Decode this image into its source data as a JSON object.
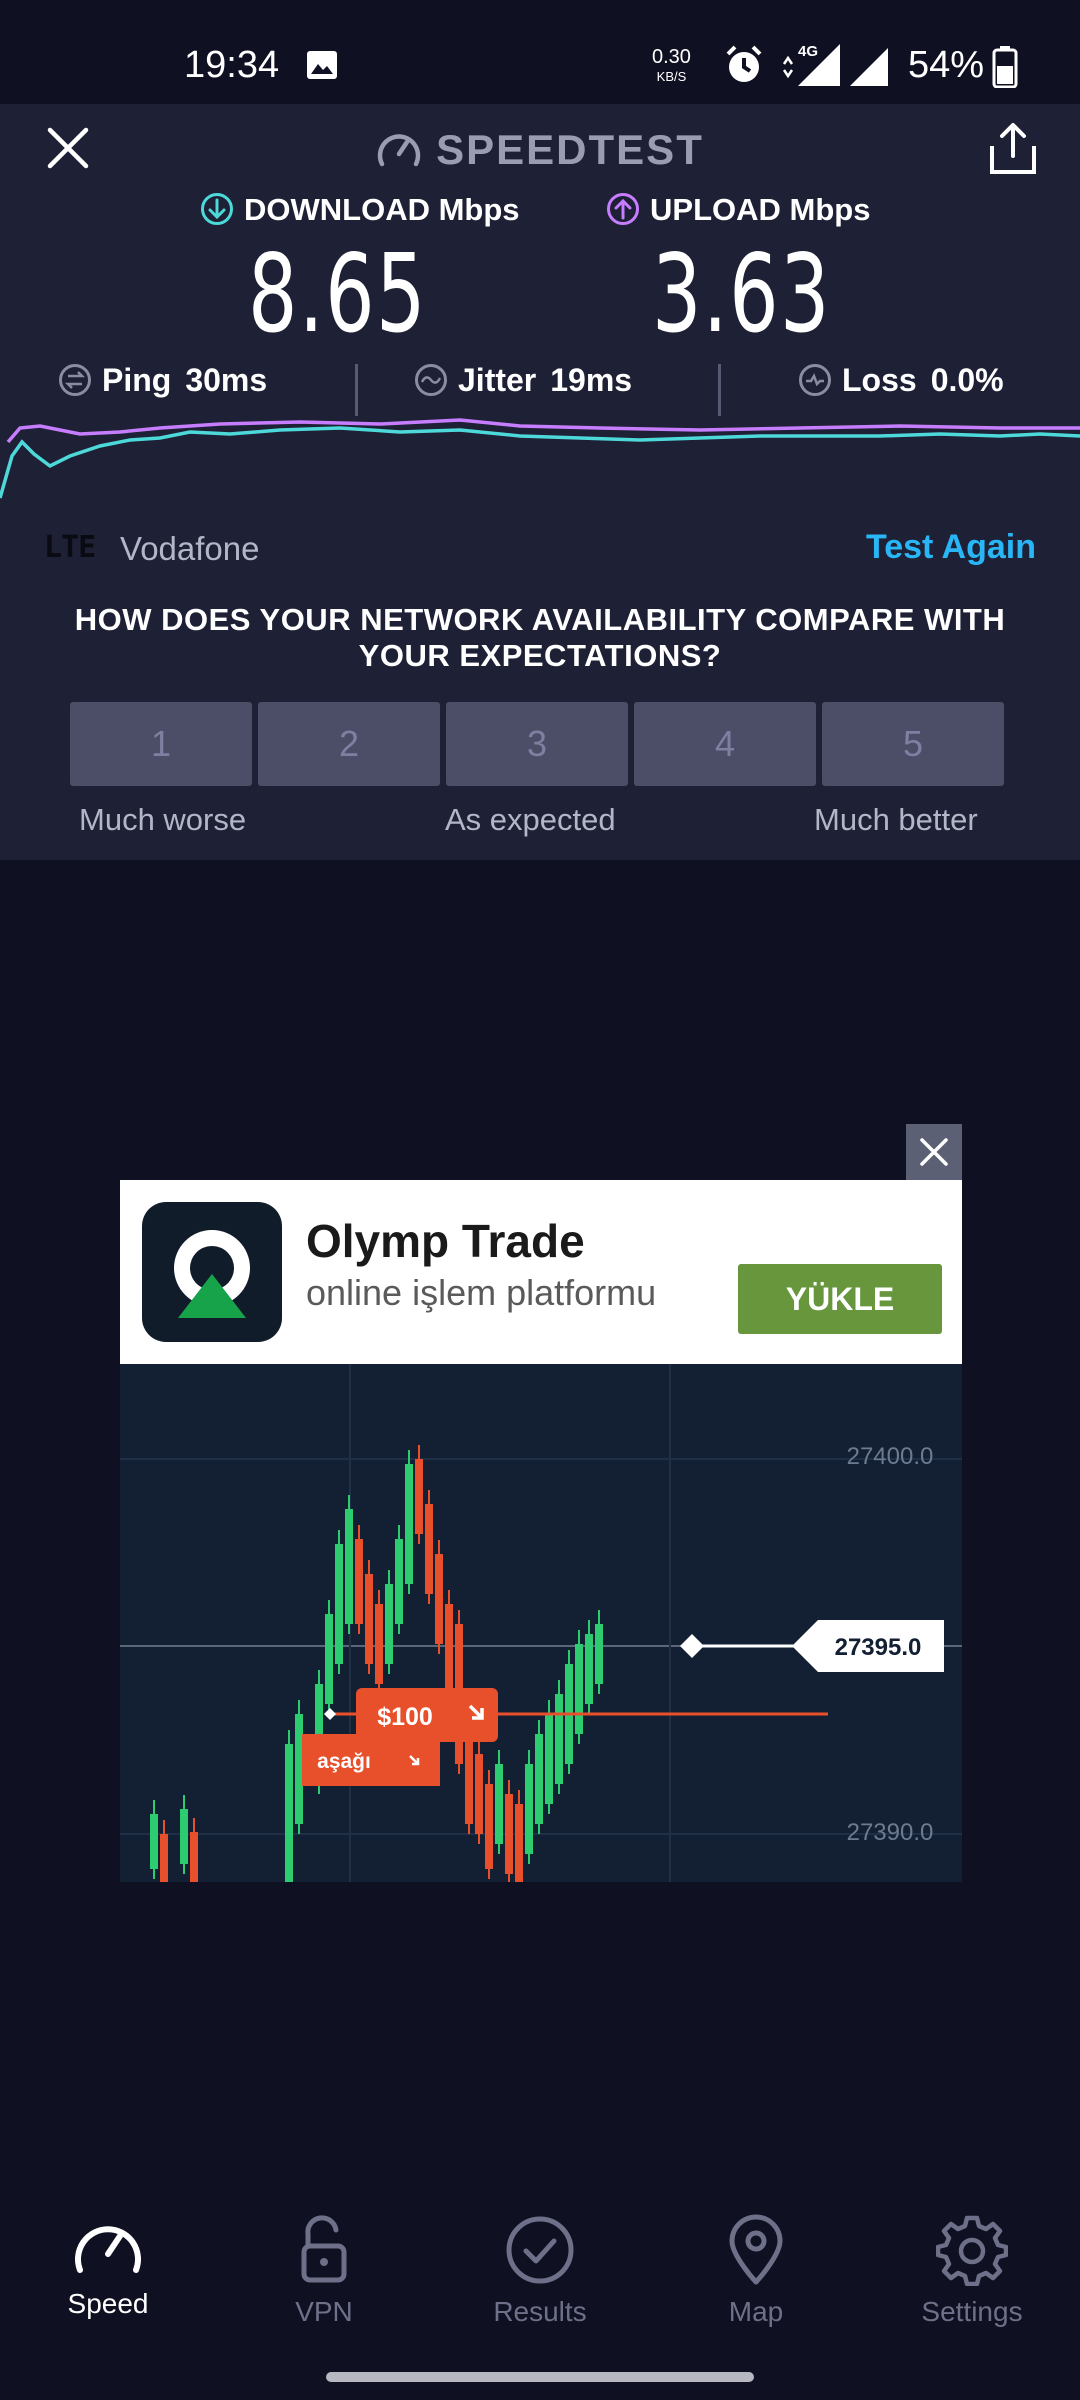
{
  "status_bar": {
    "time": "19:34",
    "net_speed_value": "0.30",
    "net_speed_unit": "KB/S",
    "network_type": "4G",
    "battery": "54%"
  },
  "header": {
    "title": "SPEEDTEST"
  },
  "results": {
    "download_label": "DOWNLOAD Mbps",
    "download_value": "8.65",
    "upload_label": "UPLOAD Mbps",
    "upload_value": "3.63",
    "ping_label": "Ping",
    "ping_value": "30ms",
    "jitter_label": "Jitter",
    "jitter_value": "19ms",
    "loss_label": "Loss",
    "loss_value": "0.0%"
  },
  "connection": {
    "type": "LTE",
    "carrier": "Vodafone",
    "test_again": "Test Again"
  },
  "survey": {
    "question": "HOW DOES YOUR NETWORK AVAILABILITY COMPARE WITH YOUR EXPECTATIONS?",
    "options": [
      "1",
      "2",
      "3",
      "4",
      "5"
    ],
    "scale_low": "Much worse",
    "scale_mid": "As expected",
    "scale_high": "Much better"
  },
  "ad": {
    "title": "Olymp Trade",
    "subtitle": "online işlem platformu",
    "cta": "YÜKLE",
    "price_high": "27400.0",
    "price_current": "27395.0",
    "price_low": "27390.0",
    "trade_amount": "$100",
    "trade_direction": "aşağı"
  },
  "nav": {
    "items": [
      {
        "label": "Speed",
        "icon": "speedometer-icon"
      },
      {
        "label": "VPN",
        "icon": "lock-icon"
      },
      {
        "label": "Results",
        "icon": "check-circle-icon"
      },
      {
        "label": "Map",
        "icon": "map-pin-icon"
      },
      {
        "label": "Settings",
        "icon": "gear-icon"
      }
    ]
  },
  "colors": {
    "background": "#0f1022",
    "panel": "#1e2035",
    "download_accent": "#4dd9d9",
    "upload_accent": "#c77dff",
    "link": "#29b6f6",
    "ad_cta": "#67963d"
  }
}
